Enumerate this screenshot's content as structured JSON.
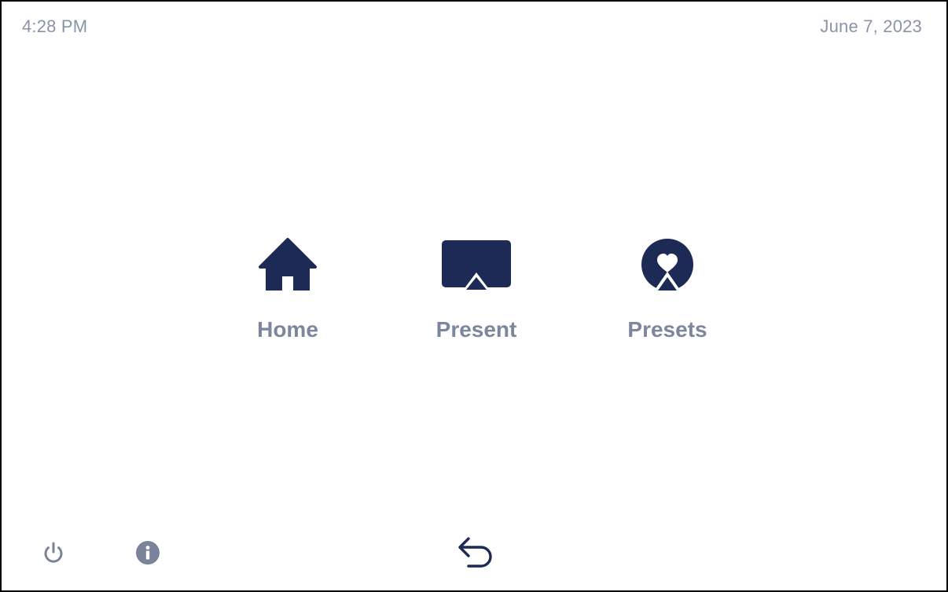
{
  "status_bar": {
    "time": "4:28 PM",
    "date": "June 7, 2023"
  },
  "nav_tiles": [
    {
      "label": "Home",
      "icon": "home-icon"
    },
    {
      "label": "Present",
      "icon": "present-screen-icon"
    },
    {
      "label": "Presets",
      "icon": "presets-heart-icon"
    }
  ],
  "footer": {
    "power_icon": "power-icon",
    "info_icon": "info-icon",
    "back_icon": "back-arrow-icon"
  },
  "colors": {
    "icon_navy": "#1e2a56",
    "label_gray": "#7d869c",
    "status_gray": "#8a93a8",
    "footer_icon_gray": "#7a8397",
    "border": "#000000",
    "background": "#ffffff"
  }
}
